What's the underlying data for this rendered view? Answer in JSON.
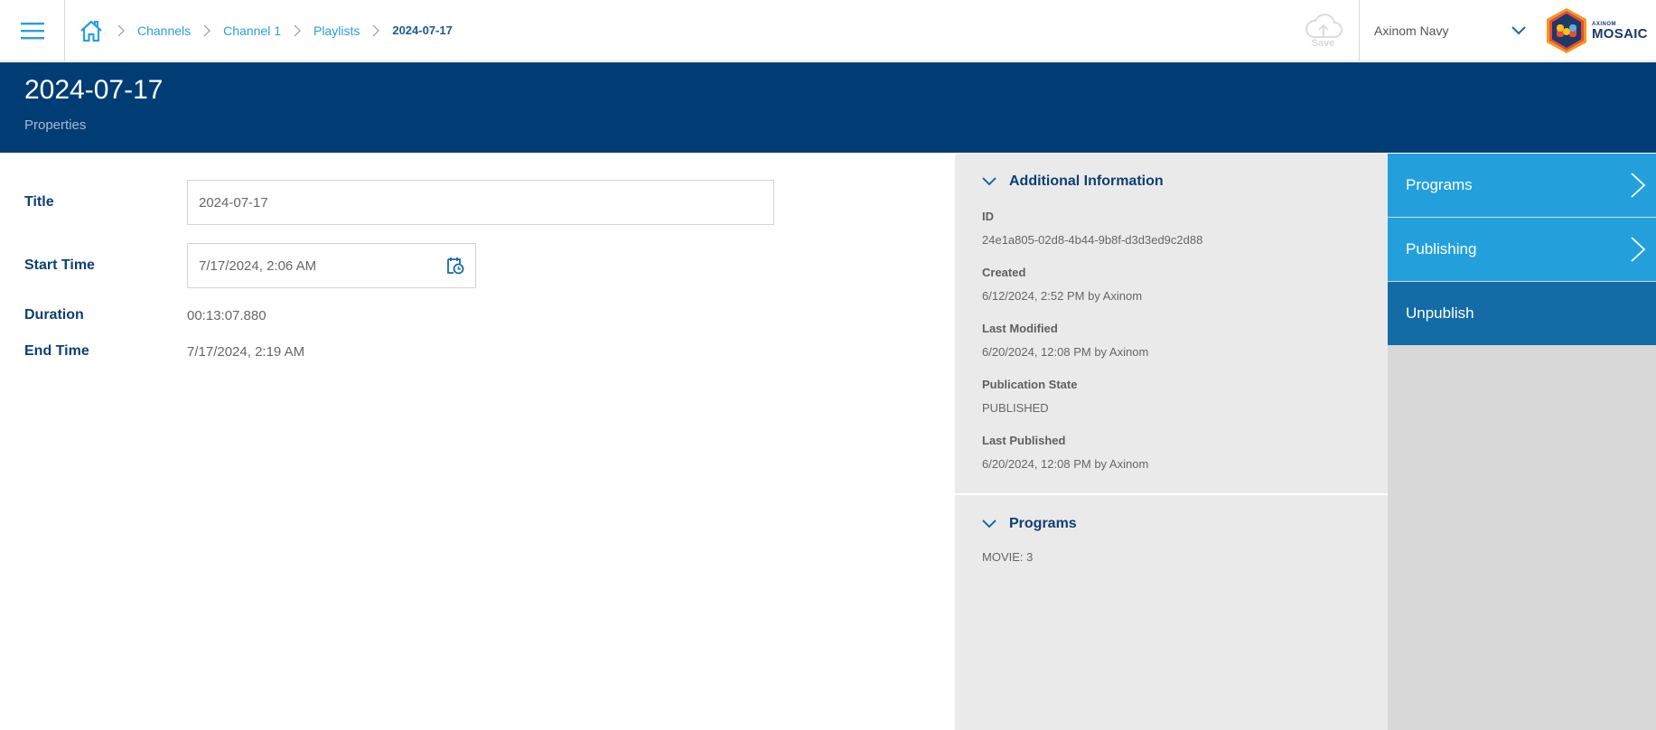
{
  "topbar": {
    "menu_icon": "hamburger-menu-icon",
    "home_icon": "home-icon",
    "breadcrumb": [
      {
        "label": "Channels"
      },
      {
        "label": "Channel 1"
      },
      {
        "label": "Playlists"
      }
    ],
    "breadcrumb_current": "2024-07-17",
    "save_label": "Save",
    "save_icon": "cloud-upload-icon",
    "tenant": "Axinom Navy",
    "logo_small": "AXINOM",
    "logo_big": "MOSAIC"
  },
  "header": {
    "title": "2024-07-17",
    "subtitle": "Properties"
  },
  "form": {
    "title_label": "Title",
    "title_value": "2024-07-17",
    "start_label": "Start Time",
    "start_value": "7/17/2024, 2:06 AM",
    "duration_label": "Duration",
    "duration_value": "00:13:07.880",
    "end_label": "End Time",
    "end_value": "7/17/2024, 2:19 AM"
  },
  "info": {
    "section_title": "Additional Information",
    "fields": [
      {
        "label": "ID",
        "value": "24e1a805-02d8-4b44-9b8f-d3d3ed9c2d88"
      },
      {
        "label": "Created",
        "value": "6/12/2024, 2:52 PM by Axinom"
      },
      {
        "label": "Last Modified",
        "value": "6/20/2024, 12:08 PM by Axinom"
      },
      {
        "label": "Publication State",
        "value": "PUBLISHED"
      },
      {
        "label": "Last Published",
        "value": "6/20/2024, 12:08 PM by Axinom"
      }
    ],
    "programs_title": "Programs",
    "programs_value": "MOVIE: 3"
  },
  "actions": [
    {
      "label": "Programs",
      "has_chevron": true
    },
    {
      "label": "Publishing",
      "has_chevron": true
    },
    {
      "label": "Unpublish",
      "has_chevron": false
    }
  ],
  "colors": {
    "brand_navy": "#013d75",
    "accent_blue": "#23a0dc",
    "dark_action": "#136ca6",
    "link": "#2a9fd8"
  }
}
